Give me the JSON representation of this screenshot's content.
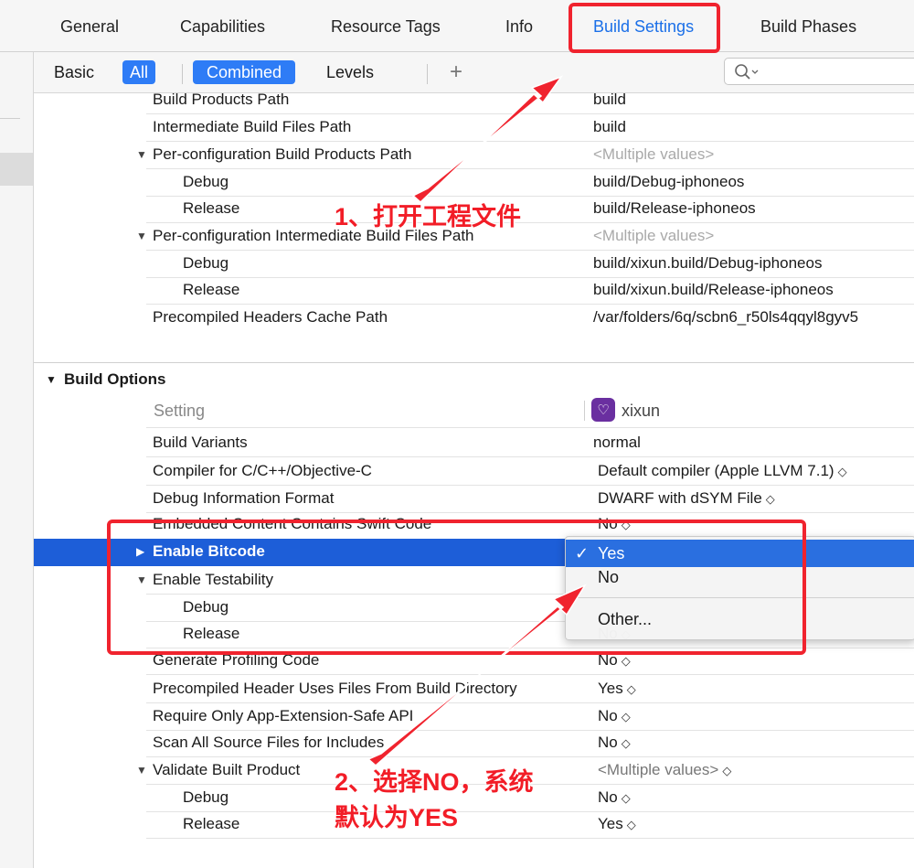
{
  "tabs": [
    {
      "label": "General"
    },
    {
      "label": "Capabilities"
    },
    {
      "label": "Resource Tags"
    },
    {
      "label": "Info"
    },
    {
      "label": "Build Settings",
      "active": true
    },
    {
      "label": "Build Phases"
    }
  ],
  "filters": {
    "basic": "Basic",
    "all": "All",
    "combined": "Combined",
    "levels": "Levels",
    "add": "+"
  },
  "search": {
    "icon": "search-icon"
  },
  "paths": [
    {
      "setting": "Build Products Path",
      "value": "build"
    },
    {
      "setting": "Intermediate Build Files Path",
      "value": "build"
    },
    {
      "setting": "Per-configuration Build Products Path",
      "value": "<Multiple values>",
      "expanded": true
    },
    {
      "setting": "Debug",
      "value": "build/Debug-iphoneos"
    },
    {
      "setting": "Release",
      "value": "build/Release-iphoneos"
    },
    {
      "setting": "Per-configuration Intermediate Build Files Path",
      "value": "<Multiple values>",
      "expanded": true
    },
    {
      "setting": "Debug",
      "value": "build/xixun.build/Debug-iphoneos"
    },
    {
      "setting": "Release",
      "value": "build/xixun.build/Release-iphoneos"
    },
    {
      "setting": "Precompiled Headers Cache Path",
      "value": "/var/folders/6q/scbn6_r50ls4qqyl8gyv5"
    }
  ],
  "build_options": {
    "title": "Build Options",
    "header_setting": "Setting",
    "header_target": "xixun",
    "rows": [
      {
        "setting": "Build Variants",
        "value": "normal"
      },
      {
        "setting": "Compiler for C/C++/Objective-C",
        "value": "Default compiler (Apple LLVM 7.1)"
      },
      {
        "setting": "Debug Information Format",
        "value": "DWARF with dSYM File"
      },
      {
        "setting": "Embedded Content Contains Swift Code",
        "value": "No"
      },
      {
        "setting": "Enable Bitcode",
        "value": "Yes",
        "selected": true
      },
      {
        "setting": "Enable Testability",
        "value": "",
        "expanded": true
      },
      {
        "setting": "Debug",
        "value": ""
      },
      {
        "setting": "Release",
        "value": "No"
      },
      {
        "setting": "Generate Profiling Code",
        "value": "No"
      },
      {
        "setting": "Precompiled Header Uses Files From Build Directory",
        "value": "Yes"
      },
      {
        "setting": "Require Only App-Extension-Safe API",
        "value": "No"
      },
      {
        "setting": "Scan All Source Files for Includes",
        "value": "No"
      },
      {
        "setting": "Validate Built Product",
        "value": "<Multiple values>",
        "expanded": true
      },
      {
        "setting": "Debug",
        "value": "No"
      },
      {
        "setting": "Release",
        "value": "Yes"
      }
    ]
  },
  "dropdown": {
    "check": "✓",
    "options": [
      "Yes",
      "No",
      "Other..."
    ]
  },
  "annotations": {
    "step1": "1、打开工程文件",
    "step2_line1": "2、选择NO，系统",
    "step2_line2": "默认为YES",
    "color": "#f0232e"
  }
}
